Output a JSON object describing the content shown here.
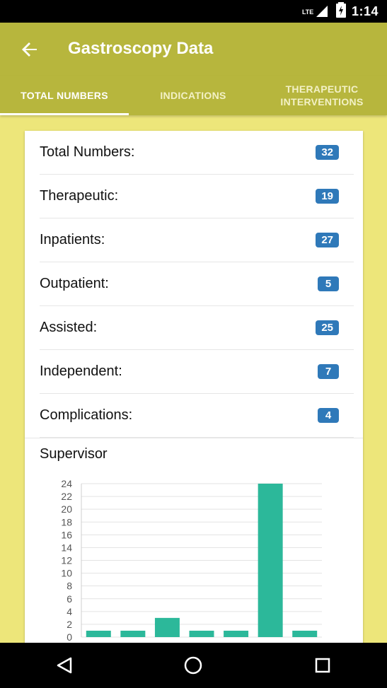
{
  "status_bar": {
    "time": "1:14",
    "network": "LTE"
  },
  "header": {
    "title": "Gastroscopy Data"
  },
  "tabs": [
    {
      "label": "TOTAL NUMBERS",
      "active": true
    },
    {
      "label": "INDICATIONS",
      "active": false
    },
    {
      "label": "THERAPEUTIC\nINTERVENTIONS",
      "active": false
    }
  ],
  "stats": [
    {
      "label": "Total Numbers:",
      "value": "32"
    },
    {
      "label": "Therapeutic:",
      "value": "19"
    },
    {
      "label": "Inpatients:",
      "value": "27"
    },
    {
      "label": "Outpatient:",
      "value": "5"
    },
    {
      "label": "Assisted:",
      "value": "25"
    },
    {
      "label": "Independent:",
      "value": "7"
    },
    {
      "label": "Complications:",
      "value": "4"
    }
  ],
  "supervisor": {
    "title": "Supervisor"
  },
  "colors": {
    "appbar": "#B7B63D",
    "background": "#EDE67A",
    "badge": "#2F79B9",
    "bar": "#2CB89A"
  },
  "chart_data": {
    "type": "bar",
    "title": "",
    "xlabel": "",
    "ylabel": "",
    "categories": [
      "",
      "",
      "",
      "",
      "",
      "",
      ""
    ],
    "values": [
      1,
      1,
      3,
      1,
      1,
      24,
      1
    ],
    "ylim": [
      0,
      24
    ],
    "yticks": [
      0,
      2,
      4,
      6,
      8,
      10,
      12,
      14,
      16,
      18,
      20,
      22,
      24
    ],
    "grid": true
  }
}
